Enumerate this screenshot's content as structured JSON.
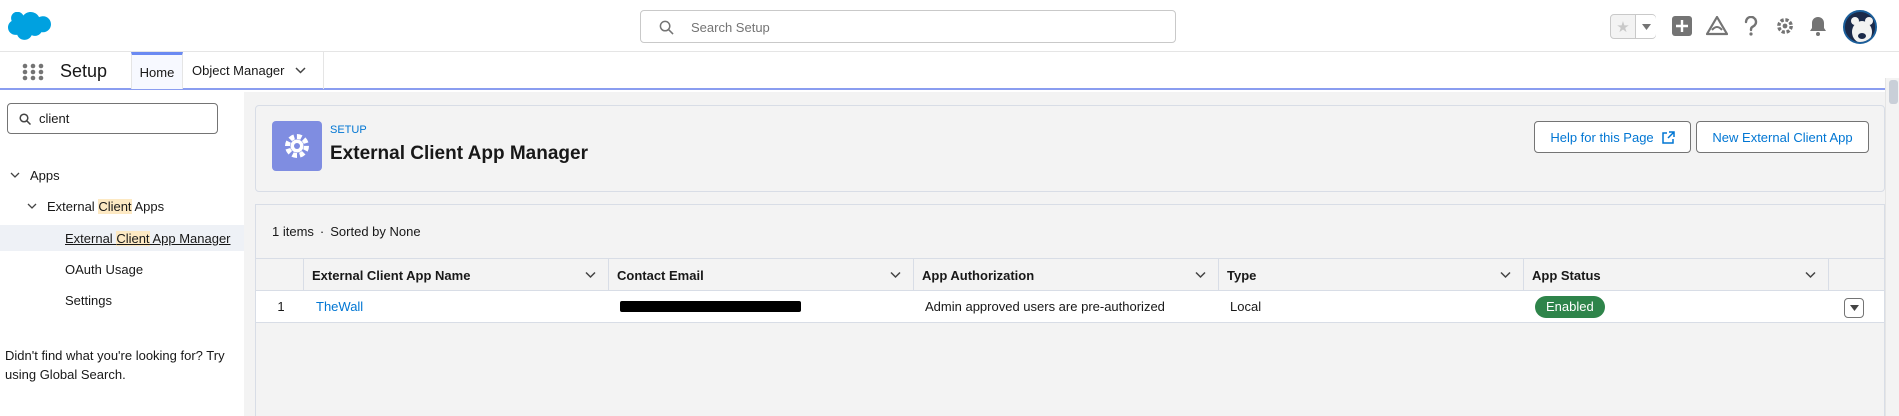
{
  "global_header": {
    "search_placeholder": "Search Setup",
    "icons": [
      "salesforce-cloud-logo",
      "favorites-star-icon",
      "chevron-down-icon",
      "global-actions-icon",
      "trailhead-icon",
      "help-icon",
      "setup-gear-icon",
      "notifications-bell-icon",
      "user-avatar"
    ]
  },
  "nav": {
    "app_name": "Setup",
    "tabs": [
      {
        "label": "Home",
        "active": true
      },
      {
        "label": "Object Manager",
        "has_dropdown": true
      }
    ]
  },
  "sidebar": {
    "quick_find_value": "client",
    "tree": {
      "apps": "Apps",
      "external_prefix": "External ",
      "client_word": "Client",
      "apps_suffix": " Apps",
      "manager_suffix": " App Manager",
      "oauth_usage": "OAuth Usage",
      "settings": "Settings"
    },
    "help_text": "Didn't find what you're looking for? Try using Global Search."
  },
  "page_header": {
    "eyebrow": "SETUP",
    "title": "External Client App Manager",
    "help_button": "Help for this Page",
    "new_button": "New External Client App"
  },
  "list": {
    "items_count": "1 items",
    "sorted_by": "Sorted by None",
    "columns": [
      "External Client App Name",
      "Contact Email",
      "App Authorization",
      "Type",
      "App Status"
    ],
    "rows": [
      {
        "row_number": "1",
        "app_name": "TheWall",
        "contact_email": "",
        "app_authorization": "Admin approved users are pre-authorized",
        "type": "Local",
        "app_status": "Enabled"
      }
    ]
  },
  "colors": {
    "brand_blue": "#0176d3",
    "header_icon_bg": "#7f8de1",
    "status_green": "#2e844a",
    "tab_accent": "#6b8af2"
  }
}
